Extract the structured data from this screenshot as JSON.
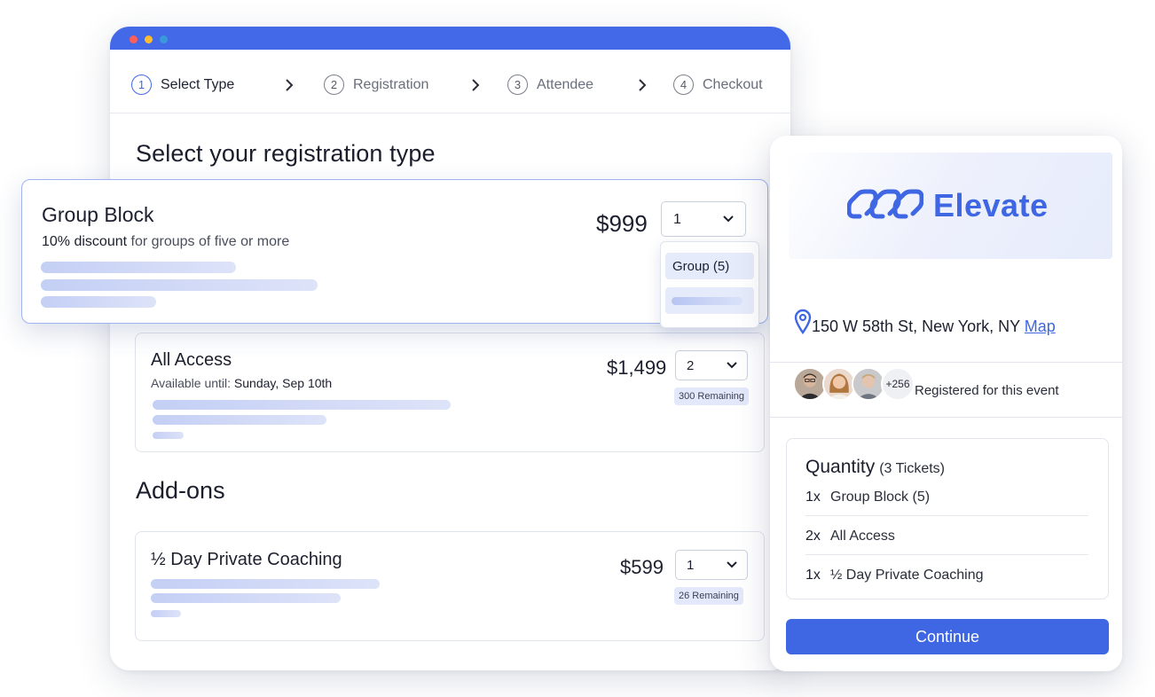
{
  "window": {
    "dots": [
      "#ff5f56",
      "#ffbd2e",
      "#3a9ad9"
    ]
  },
  "steps": [
    {
      "num": "1",
      "label": "Select Type"
    },
    {
      "num": "2",
      "label": "Registration"
    },
    {
      "num": "3",
      "label": "Attendee"
    },
    {
      "num": "4",
      "label": "Checkout"
    }
  ],
  "headings": {
    "title": "Select your registration type",
    "addons": "Add-ons"
  },
  "group_block": {
    "name": "Group Block",
    "discount": "10% discount",
    "discount_rest": " for groups of five or more",
    "price": "$999",
    "qty": "1",
    "dropdown_option": "Group (5)"
  },
  "all_access": {
    "name": "All Access",
    "avail_label": "Available until: ",
    "avail_date": "Sunday, Sep 10th",
    "price": "$1,499",
    "qty": "2",
    "remaining": "300 Remaining"
  },
  "coaching": {
    "name": "½ Day Private Coaching",
    "price": "$599",
    "qty": "1",
    "remaining": "26 Remaining"
  },
  "panel": {
    "brand": "Elevate",
    "address": "150 W 58th St, New York, NY ",
    "map_link": "Map",
    "more_count": "+256",
    "registered": "Registered for this event",
    "qty_title": "Quantity",
    "qty_sub": "(3 Tickets)",
    "items": [
      {
        "count": "1x",
        "label": "Group Block (5)"
      },
      {
        "count": "2x",
        "label": "All Access"
      },
      {
        "count": "1x",
        "label": "½ Day Private Coaching"
      }
    ],
    "continue": "Continue"
  },
  "colors": {
    "accent": "#3f67e4",
    "titlebar": "#4368e8"
  }
}
